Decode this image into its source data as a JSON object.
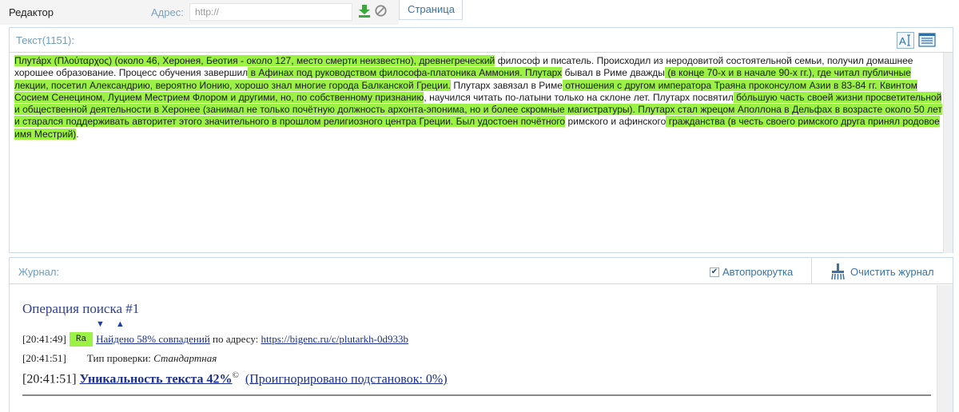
{
  "top": {
    "editor_tab": "Редактор",
    "address_label": "Адрес:",
    "address_placeholder": "http://",
    "page_tab": "Страница"
  },
  "text_panel": {
    "title": "Текст(1151):",
    "segments": [
      {
        "t": "Плута́рх (Πλούταρχος) (около 46, Херонея, Беотия - около 127, место смерти неизвестно), древнегреческий",
        "h": true
      },
      {
        "t": " философ и писатель. Происходил из неродовитой состоятельной семьи, получил домашнее хорошее образование. Процесс обучения завершил",
        "h": false
      },
      {
        "t": " в Афинах под руководством философа-платоника Аммония. Плутарх",
        "h": true
      },
      {
        "t": " бывал в Риме дважды",
        "h": false
      },
      {
        "t": " (в конце 70-х и в начале 90-х гг.), где читал публичные лекции, посетил Александрию, вероятно Ионию, хорошо знал многие города Балканской Греции.",
        "h": true
      },
      {
        "t": " Плутарх завязал в Риме",
        "h": false
      },
      {
        "t": " отношения с другом императора Траяна проконсулом Азии в 83-84 гг. Квинтом Сосием Сенецином,  Луцием Местрием Флором и другими, но, по собственному признанию",
        "h": true
      },
      {
        "t": ", научился читать по-латыни только на склоне лет. Плутарх посвятил",
        "h": false
      },
      {
        "t": " бо́льшую часть своей жизни просветительной и общественной",
        "h": true
      },
      {
        "t": " деятельности в Херонее (занимал не только почётную должность архонта-эпонима, но и более скромные магистратуры). Плутарх стал жрецом Аполлона в Дельфах в возрасте около 50 лет и старался поддерживать авторитет этого значительного в прошлом религиозного центра Греции. Был удостоен почётного",
        "h": true
      },
      {
        "t": " римского и афинского",
        "h": false
      },
      {
        "t": " гражданства (в честь своего римского друга принял родовое имя Местрий)",
        "h": true
      },
      {
        "t": ".",
        "h": false
      }
    ]
  },
  "journal": {
    "title": "Журнал:",
    "autoscroll_label": "Автопрокрутка",
    "autoscroll_checked": true,
    "clear_label": "Очистить журнал",
    "op_title": "Операция поиска #1",
    "arrows": "▼▲",
    "line1_time": "[20:41:49]",
    "line1_badge": "Ra",
    "line1_link": "Найдено 58% совпадений",
    "line1_mid": " по адресу: ",
    "line1_url": "https://bigenc.ru/c/plutarkh-0d933b",
    "line2_time": "[20:41:51]",
    "line2_label": "Тип проверки: ",
    "line2_value": "Стандартная",
    "line3_time": "[20:41:51]",
    "line3_link": "Уникальность текста 42%",
    "line3_sup": "©",
    "line3_ignored": "(Проигнорировано подстановок: 0%)"
  },
  "colors": {
    "highlight": "#9bf244",
    "link": "#1a2f8f",
    "accent": "#3b73a3"
  }
}
